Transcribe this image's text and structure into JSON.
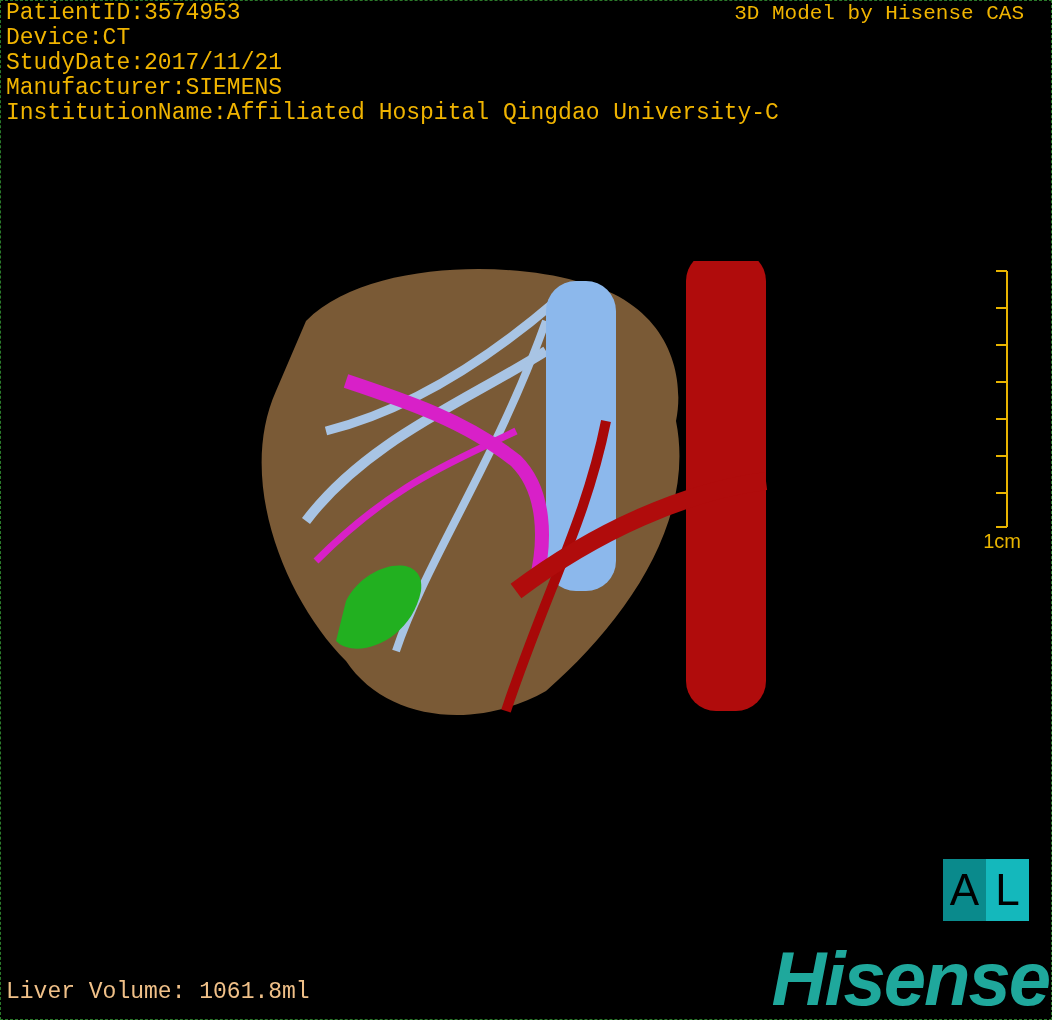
{
  "info_lines": [
    "PatientID:3574953",
    "Device:CT",
    "StudyDate:2017/11/21",
    "Manufacturer:SIEMENS",
    "InstitutionName:Affiliated Hospital Qingdao University-C"
  ],
  "title": "3D Model by Hisense CAS",
  "scale": {
    "label": "1cm"
  },
  "orientation": [
    "A",
    "L"
  ],
  "logo": "Hisense",
  "volume": "Liver Volume: 1061.8ml"
}
